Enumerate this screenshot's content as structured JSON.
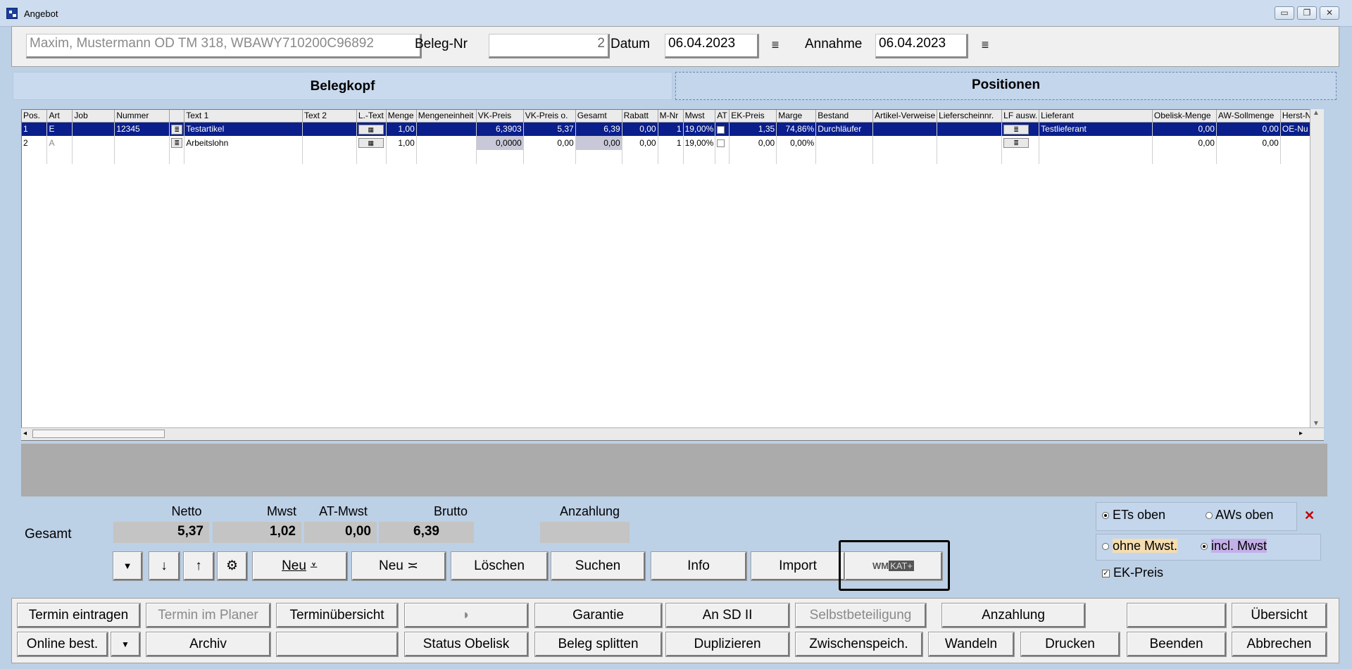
{
  "window": {
    "title": "Angebot",
    "minimize": "▭",
    "restore": "❐",
    "close": "✕"
  },
  "header": {
    "customer": "Maxim, Mustermann OD TM 318, WBAWY710200C96892",
    "beleg_nr_label": "Beleg-Nr",
    "beleg_nr": "2",
    "datum_label": "Datum",
    "datum": "06.04.2023",
    "annahme_label": "Annahme",
    "annahme": "06.04.2023"
  },
  "tabs": {
    "belegkopf": "Belegkopf",
    "positionen": "Positionen"
  },
  "grid": {
    "columns": [
      "Pos.",
      "Art",
      "Job",
      "Nummer",
      "",
      "Text 1",
      "Text 2",
      "L.-Text",
      "Menge",
      "Mengeneinheit",
      "VK-Preis",
      "VK-Preis o.",
      "Gesamt",
      "Rabatt",
      "M-Nr",
      "Mwst",
      "AT",
      "EK-Preis",
      "Marge",
      "Bestand",
      "Artikel-Verweise",
      "Lieferscheinnr.",
      "LF ausw.",
      "Lieferant",
      "Obelisk-Menge",
      "AW-Sollmenge",
      "Herst-N"
    ],
    "rows": [
      {
        "pos": "1",
        "art": "E",
        "job": "",
        "nummer": "12345",
        "text1": "Testartikel",
        "text2": "",
        "menge": "1,00",
        "einheit": "",
        "vk": "6,3903",
        "vko": "5,37",
        "gesamt": "6,39",
        "rabatt": "0,00",
        "mnr": "1",
        "mwst": "19,00%",
        "ek": "1,35",
        "marge": "74,86%",
        "bestand": "Durchläufer",
        "verweise": "",
        "lieferschein": "",
        "lieferant": "Testlieferant",
        "obelisk": "0,00",
        "aw": "0,00",
        "herst": "OE-Nu"
      },
      {
        "pos": "2",
        "art": "A",
        "job": "",
        "nummer": "",
        "text1": "Arbeitslohn",
        "text2": "",
        "menge": "1,00",
        "einheit": "",
        "vk": "0,0000",
        "vko": "0,00",
        "gesamt": "0,00",
        "rabatt": "0,00",
        "mnr": "1",
        "mwst": "19,00%",
        "ek": "0,00",
        "marge": "0,00%",
        "bestand": "",
        "verweise": "",
        "lieferschein": "",
        "lieferant": "",
        "obelisk": "0,00",
        "aw": "0,00",
        "herst": ""
      }
    ]
  },
  "totals": {
    "netto_label": "Netto",
    "netto": "5,37",
    "mwst_label": "Mwst",
    "mwst": "1,02",
    "atmwst_label": "AT-Mwst",
    "atmwst": "0,00",
    "brutto_label": "Brutto",
    "brutto": "6,39",
    "anzahlung_label": "Anzahlung",
    "anzahlung": "",
    "gesamt_label": "Gesamt"
  },
  "toolbar": {
    "neu1": "Neu",
    "neu2": "Neu",
    "loeschen": "Löschen",
    "suchen": "Suchen",
    "info": "Info",
    "import": "Import",
    "wmkat_wm": "WM",
    "wmkat_kat": "KAT+"
  },
  "options": {
    "ets_oben": "ETs oben",
    "aws_oben": "AWs oben",
    "ohne_mwst": "ohne Mwst.",
    "incl_mwst": "incl. Mwst",
    "ek_preis": "EK-Preis"
  },
  "bottom": {
    "row1": [
      "Termin eintragen",
      "Termin im Planer",
      "Terminübersicht",
      "",
      "Garantie",
      "An SD II",
      "Selbstbeteiligung",
      "Anzahlung",
      "",
      "Übersicht"
    ],
    "row2": [
      "Online best.",
      "Archiv",
      "",
      "Status Obelisk",
      "Beleg splitten",
      "Duplizieren",
      "Zwischenspeich.",
      "Wandeln",
      "Drucken",
      "Beenden",
      "Abbrechen"
    ]
  }
}
